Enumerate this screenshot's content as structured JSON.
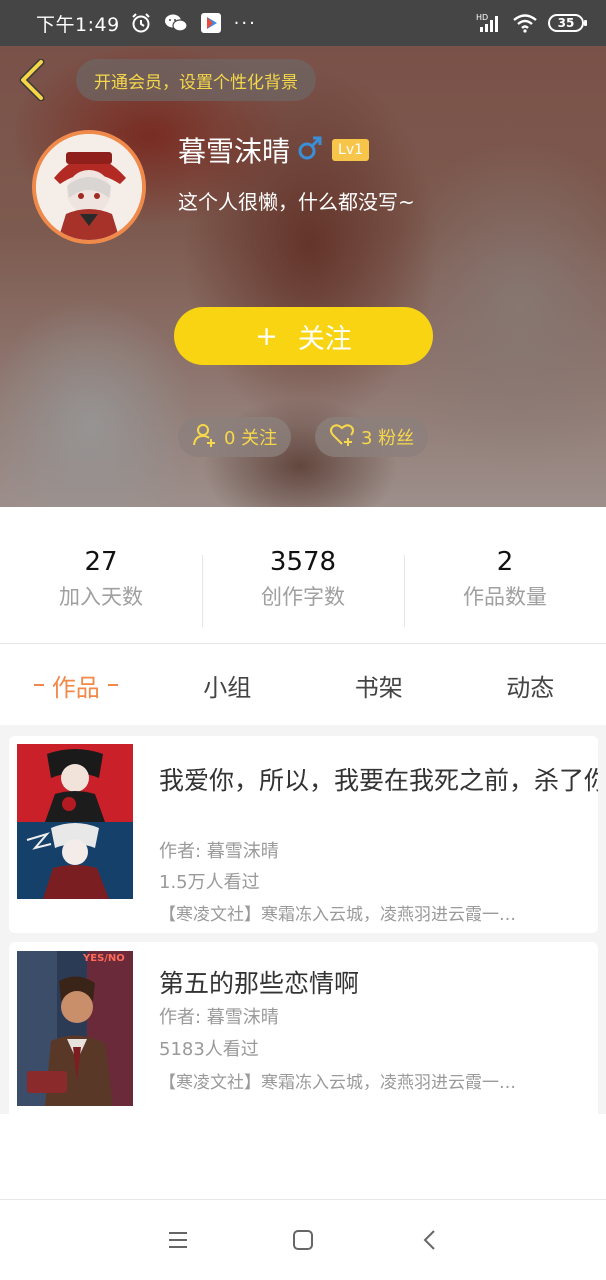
{
  "status_bar": {
    "time": "下午1:49",
    "more": "···",
    "battery": "35",
    "icons": [
      "alarm-icon",
      "wechat-icon",
      "play-store-icon",
      "hd-signal-icon",
      "wifi-icon",
      "battery-icon"
    ]
  },
  "header": {
    "vip_prompt": "开通会员，设置个性化背景",
    "username": "暮雪沫晴",
    "gender_icon": "male-icon",
    "level": "Lv1",
    "bio": "这个人很懒，什么都没写~",
    "follow_button": {
      "plus": "+",
      "label": "关注"
    },
    "following_chip": "0 关注",
    "fans_chip": "3 粉丝",
    "colors": {
      "accent_yellow": "#f9d412",
      "chip_text": "#f7d84a",
      "avatar_ring": "#f08a4b"
    }
  },
  "stats": [
    {
      "value": "27",
      "label": "加入天数"
    },
    {
      "value": "3578",
      "label": "创作字数"
    },
    {
      "value": "2",
      "label": "作品数量"
    }
  ],
  "tabs": [
    {
      "label": "作品",
      "active": true
    },
    {
      "label": "小组",
      "active": false
    },
    {
      "label": "书架",
      "active": false
    },
    {
      "label": "动态",
      "active": false
    }
  ],
  "works": [
    {
      "title": "我爱你，所以，我要在我死之前，杀了你",
      "author": "作者: 暮雪沫晴",
      "views": "1.5万人看过",
      "tag": "【寒凌文社】寒霜冻入云城，凌燕羽进云霞一…"
    },
    {
      "title": "第五的那些恋情啊",
      "author": "作者: 暮雪沫晴",
      "views": "5183人看过",
      "tag": "【寒凌文社】寒霜冻入云城，凌燕羽进云霞一…",
      "cover_sign": "YES/NO"
    }
  ],
  "nav": [
    "menu-icon",
    "home-icon",
    "back-icon"
  ]
}
